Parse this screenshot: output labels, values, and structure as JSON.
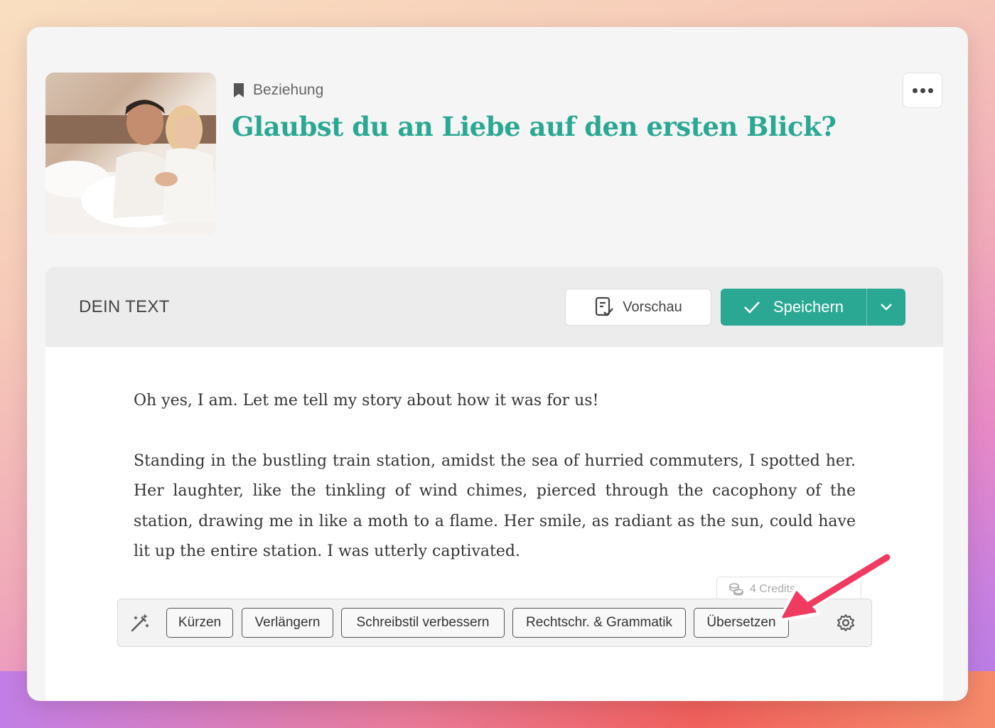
{
  "card": {
    "category_icon": "bookmark-icon",
    "category": "Beziehung",
    "title": "Glaubst du an Liebe auf den ersten Blick?",
    "more_icon": "more-horizontal-icon"
  },
  "editor": {
    "label": "DEIN TEXT",
    "preview_label": "Vorschau",
    "preview_icon": "document-check-icon",
    "save_label": "Speichern",
    "save_icon": "check-icon",
    "save_menu_icon": "chevron-down-icon",
    "paragraphs": [
      "Oh yes, I am. Let me tell my story about how it was for us!",
      "Standing in the bustling train station, amidst the sea of hurried commuters, I spotted her. Her laughter, like the tinkling of wind chimes, pierced through the cacophony of the station, drawing me in like a moth to a flame. Her smile, as radiant as the sun, could have lit up the entire station. I was utterly captivated."
    ]
  },
  "toolbar": {
    "wand_icon": "magic-wand-icon",
    "credits_text": "4 Credits",
    "credits_icon": "coins-icon",
    "actions": [
      "Kürzen",
      "Verlängern",
      "Schreibstil verbessern",
      "Rechtschr. & Grammatik",
      "Übersetzen"
    ],
    "settings_icon": "gear-icon"
  },
  "colors": {
    "accent": "#2aa893",
    "annotation_arrow": "#f03a5f"
  }
}
